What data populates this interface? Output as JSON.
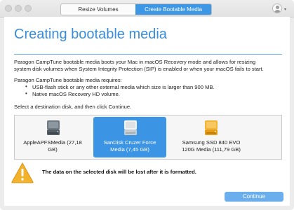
{
  "window": {
    "tabs": [
      {
        "label": "Resize Volumes",
        "active": false
      },
      {
        "label": "Create Bootable Media",
        "active": true
      }
    ],
    "accent_color": "#3d97e5"
  },
  "main": {
    "heading": "Creating bootable media",
    "intro_line1": "Paragon CampTune bootable media boots your Mac in macOS Recovery mode and allows for resizing",
    "intro_line2": "system disk volumes when System Integrity Protection (SIP) is enabled or when your macOS fails to start.",
    "requires_label": "Paragon CampTune bootable media requires:",
    "requirements": [
      "USB-flash stick or any other external media which size is larger than 900 MB.",
      "Native macOS Recovery HD volume."
    ],
    "select_prompt": "Select a destination disk, and then click Continue.",
    "disks": [
      {
        "line1": "AppleAPFSMedia (27,18",
        "line2": "GB)",
        "icon": "internal-drive-icon",
        "selected": false
      },
      {
        "line1": "SanDisk Cruzer Force",
        "line2": "Media (7,45 GB)",
        "icon": "usb-drive-icon",
        "selected": true
      },
      {
        "line1": "Samsung SSD 840 EVO",
        "line2": "120G Media (111,79 GB)",
        "icon": "external-drive-icon",
        "selected": false
      }
    ],
    "warning": "The data on the selected disk will be lost after it is formatted.",
    "continue_label": "Continue"
  }
}
